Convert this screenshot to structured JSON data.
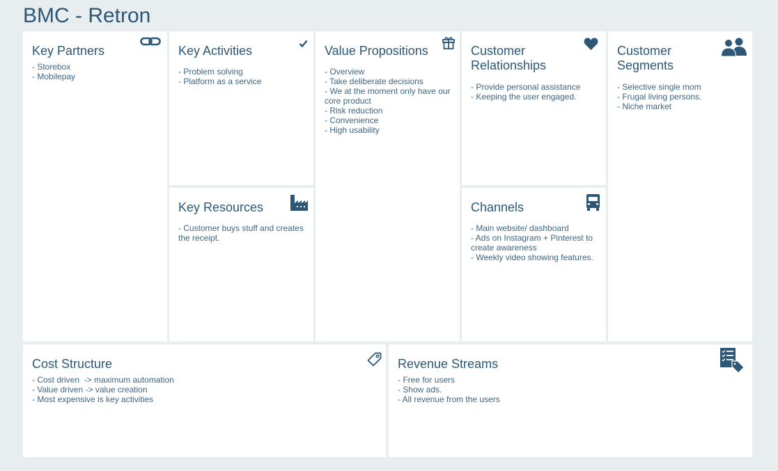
{
  "canvas": {
    "title": "BMC - Retron"
  },
  "blocks": {
    "key_partners": {
      "title": "Key Partners",
      "icon": "link-icon",
      "items": [
        "- Storebox",
        "- Mobilepay"
      ]
    },
    "key_activities": {
      "title": "Key Activities",
      "icon": "check-icon",
      "items": [
        "- Problem solving",
        "- Platform as a service"
      ]
    },
    "key_resources": {
      "title": "Key Resources",
      "icon": "factory-icon",
      "items": [
        "- Customer buys stuff and creates the receipt."
      ]
    },
    "value_propositions": {
      "title": "Value Propositions",
      "icon": "gift-icon",
      "items": [
        "- Overview",
        "- Take deliberate decisions",
        "- We at the moment only have our core product",
        "- Risk reduction",
        "- Convenience",
        "- High usability"
      ]
    },
    "customer_relationships": {
      "title": "Customer\nRelationships",
      "icon": "heart-icon",
      "items": [
        "- Provide personal assistance",
        "- Keeping the user engaged."
      ]
    },
    "channels": {
      "title": "Channels",
      "icon": "truck-icon",
      "items": [
        "- Main website/ dashboard",
        "- Ads on Instagram + Pinterest to create awareness",
        "- Weekly video showing features."
      ]
    },
    "customer_segments": {
      "title": "Customer\nSegments",
      "icon": "users-icon",
      "items": [
        "- Selective single mom",
        "- Frugal living persons.",
        "- Niche market"
      ]
    },
    "cost_structure": {
      "title": "Cost Structure",
      "icon": "tag-icon",
      "items": [
        "- Cost driven  -> maximum automation",
        "- Value driven -> value creation",
        "- Most expensive is key activities"
      ]
    },
    "revenue_streams": {
      "title": "Revenue Streams",
      "icon": "checklist-tag-icon",
      "items": [
        "- Free for users",
        "- Show ads.",
        "- All revenue from the users"
      ]
    }
  },
  "colors": {
    "background": "#e8edf0",
    "block": "#ffffff",
    "accent": "#2c5777"
  }
}
